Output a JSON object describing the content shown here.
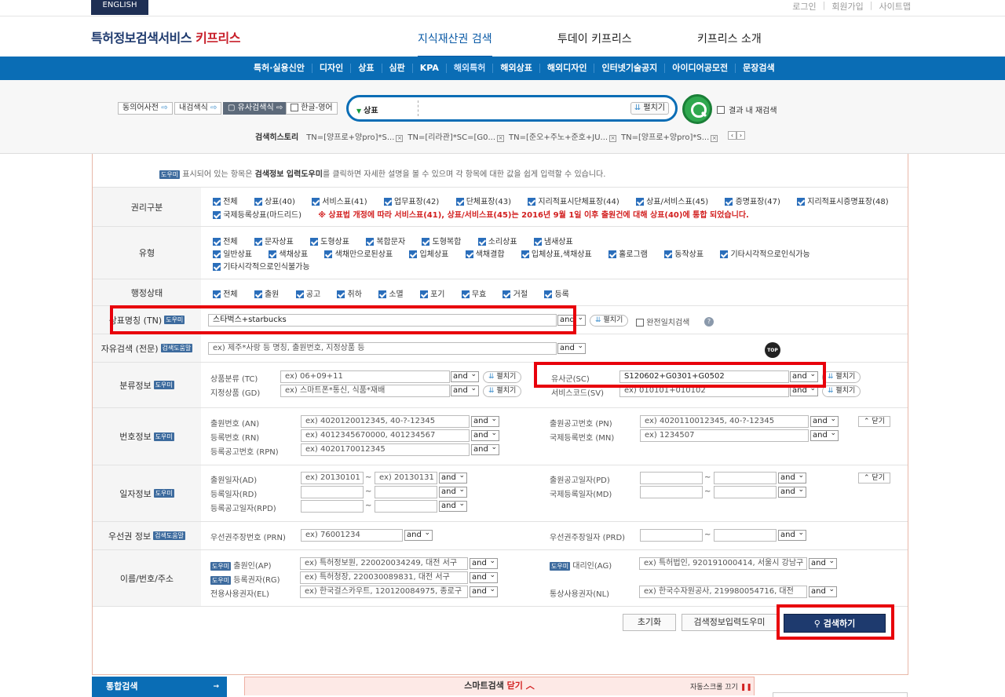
{
  "topbar": {
    "english": "ENGLISH",
    "links": [
      "로그인",
      "회원가입",
      "사이트맵"
    ]
  },
  "header": {
    "logo_main": "특허정보검색서비스",
    "logo_brand": "키프리스",
    "nav": [
      "지식재산권 검색",
      "투데이 키프리스",
      "키프리스 소개"
    ]
  },
  "subnav": [
    "특허·실용신안",
    "디자인",
    "상표",
    "심판",
    "KPA",
    "해외특허",
    "해외상표",
    "해외디자인",
    "인터넷기술공지",
    "아이디어공모전",
    "문장검색"
  ],
  "toolchips": {
    "dict": "동의어사전",
    "inner": "내검색식",
    "similar": "유사검색식",
    "hanen": "한글-영어"
  },
  "search": {
    "category": "상표",
    "open": "펼치기",
    "recheck": "결과 내 재검색"
  },
  "history": {
    "label": "검색히스토리",
    "items": [
      "TN=[양프로+양pro]*S...",
      "TN=[리라관]*SC=[G0...",
      "TN=[준오+주노+준호+JU...",
      "TN=[양프로+양pro]*S..."
    ]
  },
  "notice": {
    "badge": "도우미",
    "pre": "표시되어 있는 항목은",
    "bold": "검색정보 입력도우미",
    "post": "를 클릭하면 자세한 설명을 볼 수 있으며 각 항목에 대한 값을 쉽게 입력할 수 있습니다."
  },
  "rights": {
    "label": "권리구분",
    "row1": [
      "전체",
      "상표(40)",
      "서비스표(41)",
      "업무표장(42)",
      "단체표장(43)",
      "지리적표시단체표장(44)",
      "상표/서비스표(45)",
      "증명표장(47)",
      "지리적표시증명표장(48)"
    ],
    "row2": [
      "국제등록상표(마드리드)"
    ],
    "warning": "※ 상표법 개정에 따라 서비스표(41), 상표/서비스표(45)는 2016년 9월 1일 이후 출원건에 대해 상표(40)에 통합 되었습니다."
  },
  "types": {
    "label": "유형",
    "row1": [
      "전체",
      "문자상표",
      "도형상표",
      "복합문자",
      "도형복합",
      "소리상표",
      "냄새상표"
    ],
    "row2": [
      "일반상표",
      "색채상표",
      "색채만으로된상표",
      "입체상표",
      "색채결합",
      "입체상표,색채상표",
      "홀로그램",
      "동작상표",
      "기타시각적으로인식가능"
    ],
    "row3": [
      "기타시각적으로인식불가능"
    ]
  },
  "status": {
    "label": "행정상태",
    "items": [
      "전체",
      "출원",
      "공고",
      "취하",
      "소멸",
      "포기",
      "무효",
      "거절",
      "등록"
    ]
  },
  "tn": {
    "label": "상표명칭 (TN)",
    "badge": "도우미",
    "value": "스타벅스+starbucks",
    "op": "and",
    "open": "펼치기",
    "exact": "완전일치검색",
    "help": "?"
  },
  "free": {
    "label": "자유검색 (전문)",
    "badge": "검색도움말",
    "placeholder": "ex) 제주*사랑 등 명칭, 출원번호, 지정상품 등",
    "op": "and"
  },
  "topbtn": "TOP",
  "classinfo": {
    "label": "분류정보",
    "badge": "도우미",
    "tc_label": "상품분류 (TC)",
    "tc_ph": "ex) 06+09+11",
    "gd_label": "지정상품 (GD)",
    "gd_ph": "ex) 스마트폰*통신, 식품*재배",
    "sc_label": "유사군(SC)",
    "sc_value": "S120602+G0301+G0502",
    "svc_label": "서비스코드(SV)",
    "svc_ph": "ex) 010101+010102",
    "op": "and",
    "open": "펼치기"
  },
  "numinfo": {
    "label": "번호정보",
    "badge": "도우미",
    "an_label": "출원번호 (AN)",
    "an_ph": "ex) 4020120012345, 40-?-12345",
    "rn_label": "등록번호 (RN)",
    "rn_ph": "ex) 4012345670000, 401234567",
    "rpn_label": "등록공고번호 (RPN)",
    "rpn_ph": "ex) 4020170012345",
    "pn_label": "출원공고번호 (PN)",
    "pn_ph": "ex) 4020110012345, 40-?-12345",
    "mn_label": "국제등록번호 (MN)",
    "mn_ph": "ex) 1234507",
    "op": "and",
    "close": "닫기"
  },
  "dateinfo": {
    "label": "일자정보",
    "badge": "도우미",
    "ad_label": "출원일자(AD)",
    "ad_from": "ex) 20130101",
    "ad_to": "ex) 20130131",
    "rd_label": "등록일자(RD)",
    "rpd_label": "등록공고일자(RPD)",
    "pd_label": "출원공고일자(PD)",
    "md_label": "국제등록일자(MD)",
    "tilde": "~",
    "op": "and",
    "close": "닫기"
  },
  "priority": {
    "label": "우선권 정보",
    "badge": "검색도움말",
    "prn_label": "우선권주장번호 (PRN)",
    "prn_ph": "ex) 76001234",
    "prd_label": "우선권주장일자 (PRD)",
    "op": "and"
  },
  "names": {
    "label": "이름/번호/주소",
    "badge": "도우미",
    "ap_label": "출원인(AP)",
    "ap_ph": "ex) 특허정보원, 220020034249, 대전 서구",
    "rg_label": "등록권자(RG)",
    "rg_ph": "ex) 특허청장, 220030089831, 대전 서구",
    "el_label": "전용사용권자(EL)",
    "el_ph": "ex) 한국걸스카우트, 120120084975, 종로구",
    "ag_label": "대리인(AG)",
    "ag_ph": "ex) 특허법인, 920191000414, 서울시 강남구",
    "nl_label": "통상사용권자(NL)",
    "nl_ph": "ex) 한국수자원공사, 219980054716, 대전",
    "op": "and"
  },
  "actions": {
    "reset": "초기화",
    "helper": "검색정보입력도우미",
    "search": "검색하기"
  },
  "bottom": {
    "tong": "통합검색",
    "smart": "스마트검색",
    "smart_close": "닫기",
    "auto": "자동스크롤 끄기"
  }
}
